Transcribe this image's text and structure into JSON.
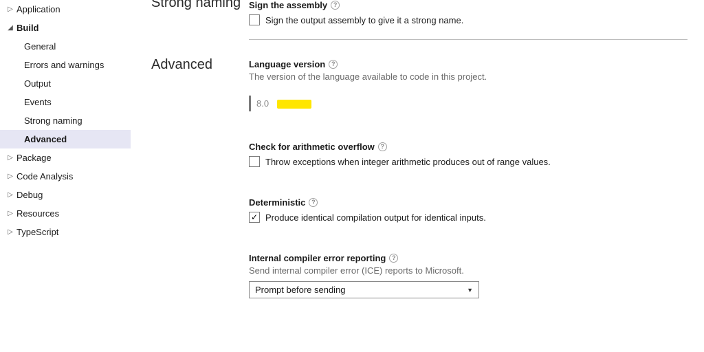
{
  "sidebar": {
    "application": "Application",
    "build": "Build",
    "build_children": {
      "general": "General",
      "errors": "Errors and warnings",
      "output": "Output",
      "events": "Events",
      "strong_naming": "Strong naming",
      "advanced": "Advanced"
    },
    "package": "Package",
    "code_analysis": "Code Analysis",
    "debug": "Debug",
    "resources": "Resources",
    "typescript": "TypeScript"
  },
  "section_labels": {
    "strong_naming": "Strong naming",
    "advanced": "Advanced"
  },
  "content": {
    "sign": {
      "title": "Sign the assembly",
      "checkbox_label": "Sign the output assembly to give it a strong name."
    },
    "lang": {
      "title": "Language version",
      "desc": "The version of the language available to code in this project.",
      "value": "8.0"
    },
    "overflow": {
      "title": "Check for arithmetic overflow",
      "checkbox_label": "Throw exceptions when integer arithmetic produces out of range values."
    },
    "deterministic": {
      "title": "Deterministic",
      "checkbox_label": "Produce identical compilation output for identical inputs."
    },
    "ice": {
      "title": "Internal compiler error reporting",
      "desc": "Send internal compiler error (ICE) reports to Microsoft.",
      "selected": "Prompt before sending"
    }
  }
}
